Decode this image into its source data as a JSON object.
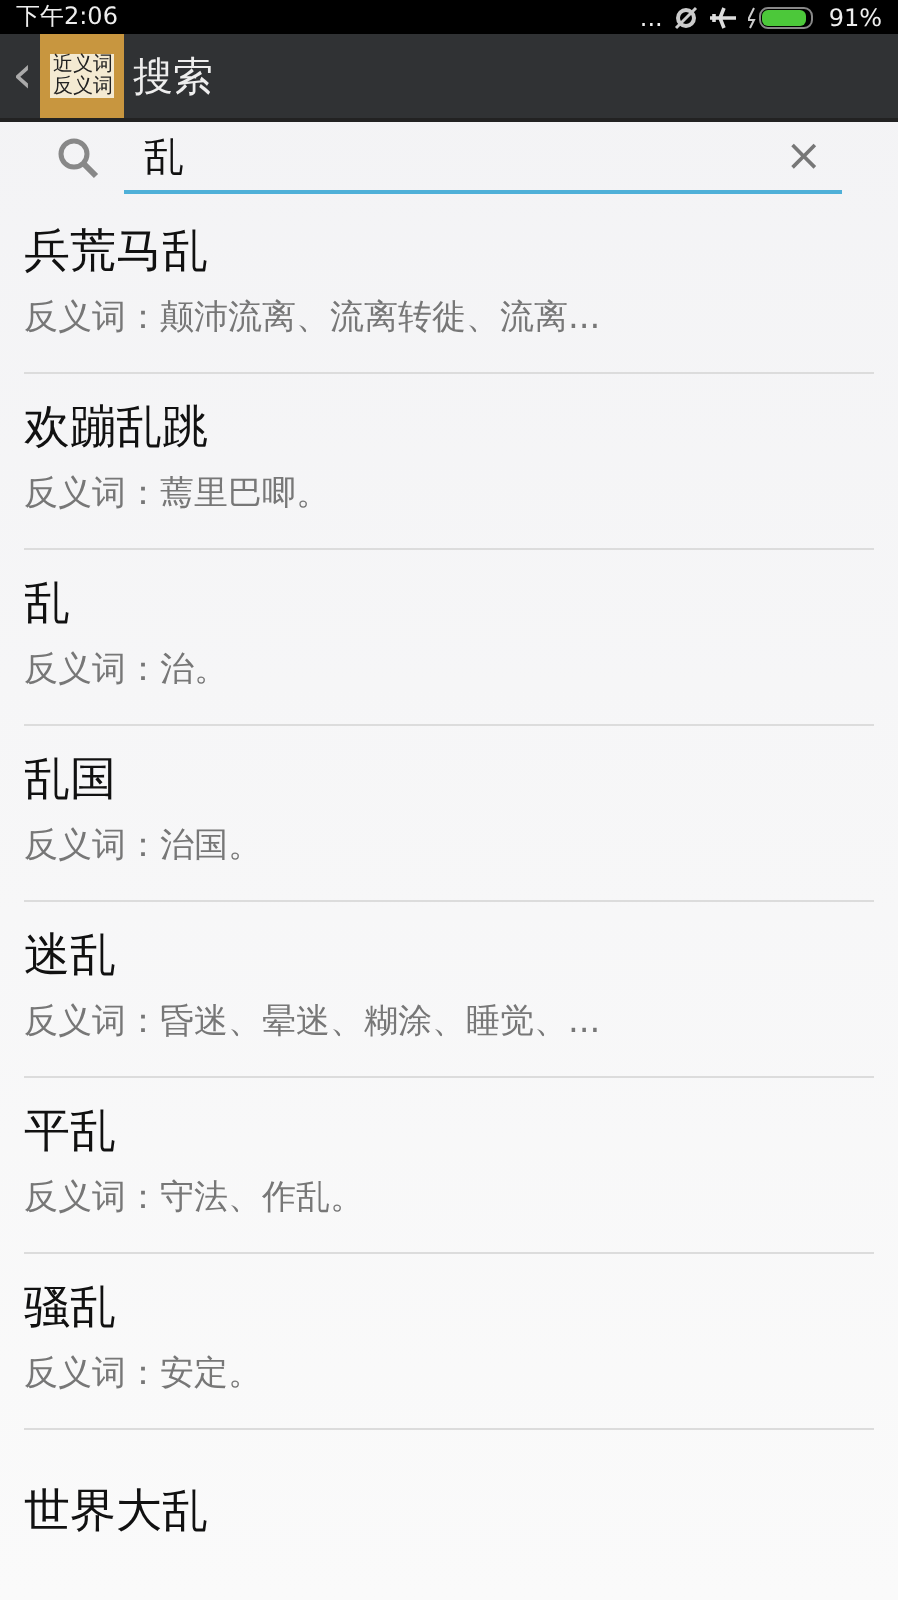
{
  "status_bar": {
    "time": "下午2:06",
    "dots": "...",
    "battery": "91%"
  },
  "action_bar": {
    "back": "‹",
    "logo_lines": [
      "近义词",
      "反义词"
    ],
    "title": "搜索"
  },
  "search": {
    "value": "乱",
    "clear": "×"
  },
  "results": [
    {
      "word": "兵荒马乱",
      "antonyms": "反义词：颠沛流离、流离转徙、流离..."
    },
    {
      "word": "欢蹦乱跳",
      "antonyms": "反义词：蔫里巴唧。"
    },
    {
      "word": "乱",
      "antonyms": "反义词：治。"
    },
    {
      "word": "乱国",
      "antonyms": "反义词：治国。"
    },
    {
      "word": "迷乱",
      "antonyms": "反义词：昏迷、晕迷、糊涂、睡觉、..."
    },
    {
      "word": "平乱",
      "antonyms": "反义词：守法、作乱。"
    },
    {
      "word": "骚乱",
      "antonyms": "反义词：安定。"
    },
    {
      "word": "世界大乱"
    }
  ]
}
